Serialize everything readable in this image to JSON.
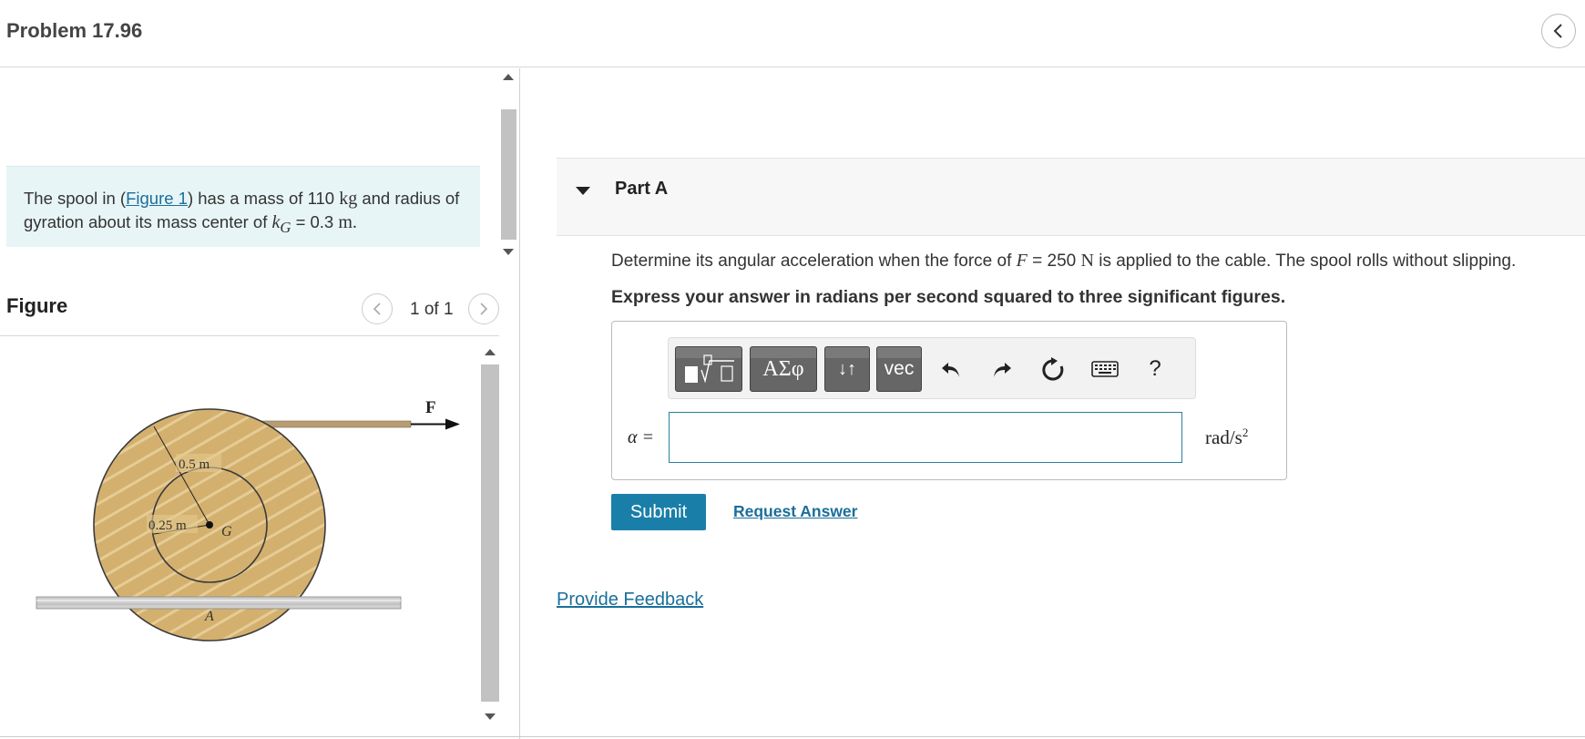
{
  "header": {
    "title": "Problem 17.96"
  },
  "intro": {
    "text_before_link": "The spool in (",
    "link_text": "Figure 1",
    "text_after_link": ") has a mass of 110",
    "mass_unit": "kg",
    "text_mid": "and radius of gyration about its mass center of",
    "kg_symbol": "k",
    "kg_sub": "G",
    "kg_value": "= 0.3",
    "kg_unit": "m."
  },
  "figure": {
    "heading": "Figure",
    "count": "1 of 1",
    "labels": {
      "force": "F",
      "outer_radius": "0.5 m",
      "inner_radius": "0.25 m",
      "center": "G",
      "contact": "A"
    },
    "colors": {
      "spool": "#d4b06f",
      "spool_edge": "#3a3a3a",
      "cable": "#b89d73",
      "ground": "#bfbfbf"
    }
  },
  "part": {
    "title": "Part A",
    "question_before": "Determine its angular acceleration when the force of",
    "force_symbol": "F",
    "force_value": "= 250",
    "force_unit": "N",
    "question_after": "is applied to the cable. The spool rolls without slipping.",
    "instruction": "Express your answer in radians per second squared to three significant figures.",
    "toolbar": {
      "templates_label": "templates",
      "greek_label": "ΑΣφ",
      "arrows_label": "↓↑",
      "vec_label": "vec",
      "help_label": "?"
    },
    "answer": {
      "variable": "α =",
      "value": "",
      "unit": "rad/s",
      "unit_power": "2"
    },
    "submit_label": "Submit",
    "request_label": "Request Answer"
  },
  "feedback_label": "Provide Feedback"
}
